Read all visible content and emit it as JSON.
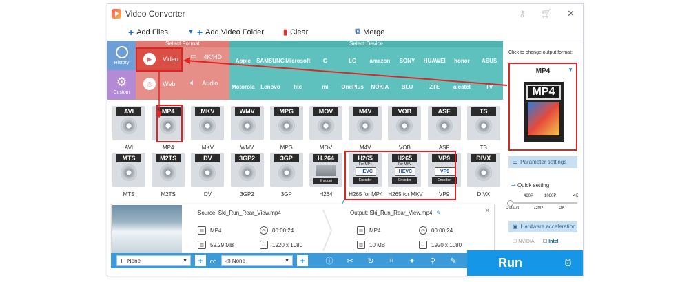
{
  "app": {
    "title": "Video Converter"
  },
  "window_controls": [
    "key-icon",
    "cart-icon",
    "close-icon"
  ],
  "toolbar": {
    "add_files": "Add Files",
    "add_video_folder": "Add Video Folder",
    "clear": "Clear",
    "merge": "Merge"
  },
  "sections": {
    "format": "Select Format",
    "device": "Select Device"
  },
  "left_nav": {
    "history": "History",
    "custom": "Custom"
  },
  "format_cats": [
    "Video",
    "4K/HD",
    "Web",
    "Audio"
  ],
  "devices_row1": [
    "Apple",
    "SAMSUNG",
    "Microsoft",
    "G",
    "LG",
    "amazon",
    "SONY",
    "HUAWEI",
    "honor",
    "ASUS"
  ],
  "devices_row2": [
    "Motorola",
    "Lenovo",
    "htc",
    "mi",
    "OnePlus",
    "NOKIA",
    "BLU",
    "ZTE",
    "alcatel",
    "TV"
  ],
  "formats_row1": [
    {
      "tag": "AVI",
      "label": "AVI"
    },
    {
      "tag": "MP4",
      "label": "MP4"
    },
    {
      "tag": "MKV",
      "label": "MKV"
    },
    {
      "tag": "WMV",
      "label": "WMV"
    },
    {
      "tag": "MPG",
      "label": "MPG"
    },
    {
      "tag": "MOV",
      "label": "MOV"
    },
    {
      "tag": "M4V",
      "label": "M4V"
    },
    {
      "tag": "VOB",
      "label": "VOB"
    },
    {
      "tag": "ASF",
      "label": "ASF"
    },
    {
      "tag": "TS",
      "label": "TS"
    }
  ],
  "formats_row2": [
    {
      "tag": "MTS",
      "label": "MTS"
    },
    {
      "tag": "M2TS",
      "label": "M2TS"
    },
    {
      "tag": "DV",
      "label": "DV"
    },
    {
      "tag": "3GP2",
      "label": "3GP2"
    },
    {
      "tag": "3GP",
      "label": "3GP"
    },
    {
      "tag": "H.264",
      "label": "H264",
      "sub": "Encoder"
    },
    {
      "tag": "H265",
      "label": "H265 for MP4",
      "sub": "For MP4",
      "codec": "HEVC",
      "sub2": "Encoder"
    },
    {
      "tag": "H265",
      "label": "H265 for MKV",
      "sub": "For MKV",
      "codec": "HEVC",
      "sub2": "Encoder"
    },
    {
      "tag": "VP9",
      "label": "VP9",
      "codec": "VP9",
      "sub2": "Encoder"
    },
    {
      "tag": "DIVX",
      "label": "DIVX"
    }
  ],
  "output": {
    "hint": "Click to change output format:",
    "current": "MP4",
    "param_settings": "Parameter settings",
    "quick_setting": "Quick setting",
    "quality_ticks_top": [
      "480P",
      "1080P",
      "4K"
    ],
    "quality_ticks_bottom": [
      "Default",
      "720P",
      "2K"
    ],
    "hw_accel": "Hardware acceleration",
    "nvidia": "NVIDIA",
    "intel": "Intel"
  },
  "file": {
    "source_label": "Source: Ski_Run_Rear_View.mp4",
    "output_label": "Output: Ski_Run_Rear_View.mp4",
    "src_format": "MP4",
    "src_duration": "00:00:24",
    "src_size": "59.29 MB",
    "src_resolution": "1920 x 1080",
    "out_format": "MP4",
    "out_duration": "00:00:24",
    "out_size": "10 MB",
    "out_resolution": "1920 x 1080"
  },
  "bottom": {
    "subtitle": "None",
    "audio": "None",
    "run": "Run"
  }
}
